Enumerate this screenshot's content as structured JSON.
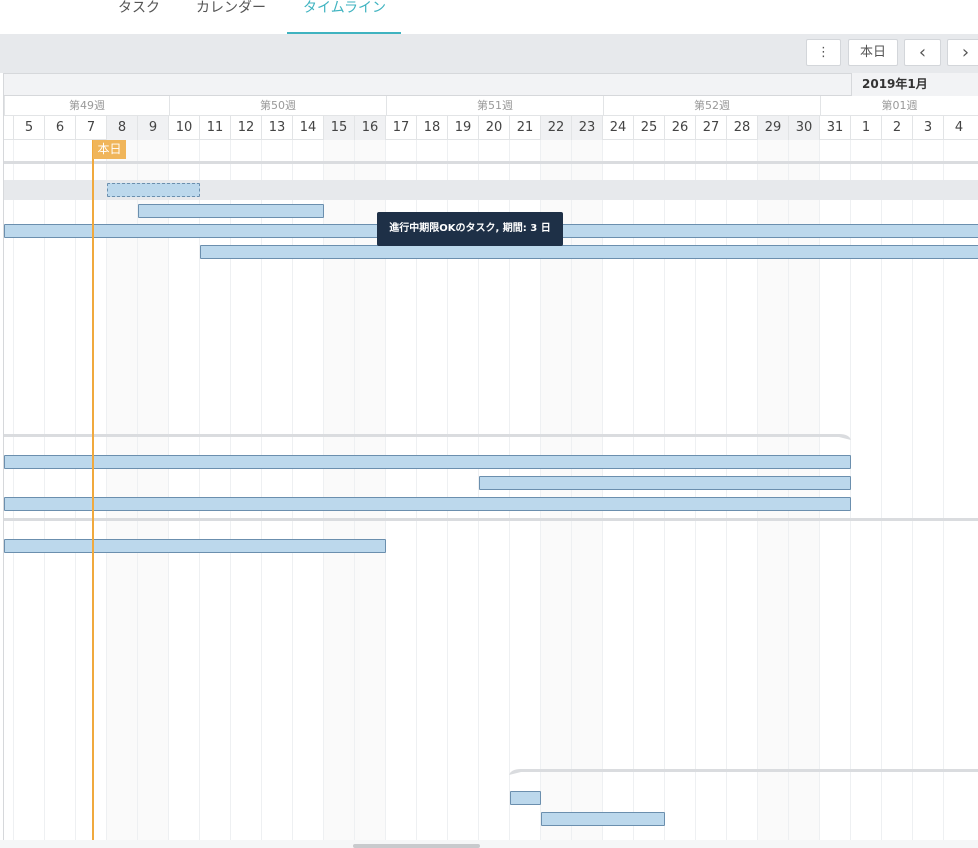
{
  "tabs": [
    {
      "label": "タスク",
      "active": false
    },
    {
      "label": "カレンダー",
      "active": false
    },
    {
      "label": "タイムライン",
      "active": true
    }
  ],
  "toolbar": {
    "more_label": "⋮",
    "today_label": "本日",
    "prev_label": "‹",
    "next_label": "›"
  },
  "timeline": {
    "month_label": "2019年1月",
    "weeks": [
      "第49週",
      "第50週",
      "第51週",
      "第52週",
      "第01週"
    ],
    "days": [
      "5",
      "6",
      "7",
      "8",
      "9",
      "10",
      "11",
      "12",
      "13",
      "14",
      "15",
      "16",
      "17",
      "18",
      "19",
      "20",
      "21",
      "22",
      "23",
      "24",
      "25",
      "26",
      "27",
      "28",
      "29",
      "30",
      "31",
      "1",
      "2",
      "3",
      "4"
    ],
    "weekend_days": [
      "8",
      "9",
      "15",
      "16",
      "22",
      "23",
      "29",
      "30"
    ],
    "today_badge": "本日"
  },
  "tooltip": {
    "text": "進行中期限OKのタスク, 期間: 3 日"
  },
  "colors": {
    "accent": "#3fb3c0",
    "today": "#f0a93e",
    "bar_fill": "#bcd8ec",
    "bar_border": "#6b8fae",
    "tooltip_bg": "#1e3047"
  }
}
